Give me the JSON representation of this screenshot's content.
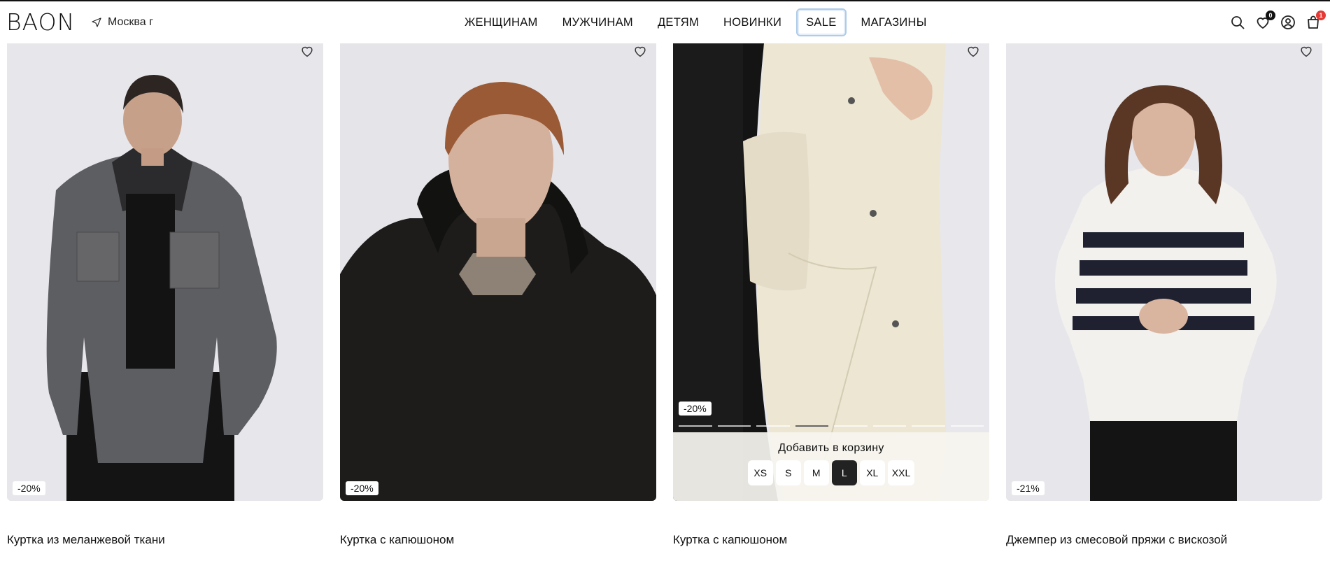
{
  "header": {
    "logo": "BAON",
    "location": "Москва г",
    "nav": [
      "ЖЕНЩИНАМ",
      "МУЖЧИНАМ",
      "ДЕТЯМ",
      "НОВИНКИ",
      "SALE",
      "МАГАЗИНЫ"
    ],
    "favorites_count": "0",
    "cart_count": "1",
    "icons": [
      "search-icon",
      "heart-icon",
      "user-icon",
      "bag-icon"
    ]
  },
  "products": [
    {
      "title": "Куртка из меланжевой ткани",
      "discount": "-20%"
    },
    {
      "title": "Куртка с капюшоном",
      "discount": "-20%"
    },
    {
      "title": "Куртка с капюшоном",
      "discount": "-20%",
      "add_to_cart": "Добавить в корзину",
      "sizes": [
        "XS",
        "S",
        "M",
        "L",
        "XL",
        "XXL"
      ],
      "selected_size": "L",
      "gallery_total": 8,
      "gallery_active": 3
    },
    {
      "title": "Джемпер из смесовой пряжи с вискозой",
      "discount": "-21%"
    }
  ],
  "colors": {
    "badge_red": "#e53935",
    "sale_focus": "#aecbe8"
  }
}
